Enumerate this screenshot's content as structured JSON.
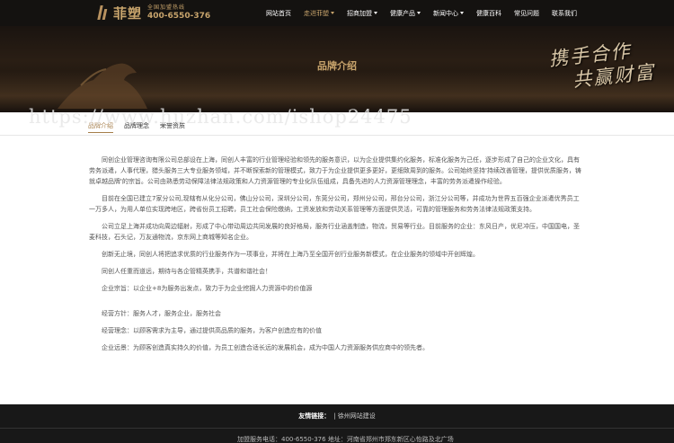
{
  "header": {
    "brand_name": "菲塑",
    "hotline_label": "全国加盟热线",
    "hotline_number": "400-6550-376"
  },
  "nav": {
    "items": [
      {
        "label": "网站首页",
        "dropdown": false,
        "active": false
      },
      {
        "label": "走进菲塑",
        "dropdown": true,
        "active": true
      },
      {
        "label": "招商加盟",
        "dropdown": true,
        "active": false
      },
      {
        "label": "健康产品",
        "dropdown": true,
        "active": false
      },
      {
        "label": "新闻中心",
        "dropdown": true,
        "active": false
      },
      {
        "label": "健康百科",
        "dropdown": false,
        "active": false
      },
      {
        "label": "常见问题",
        "dropdown": false,
        "active": false
      },
      {
        "label": "联系我们",
        "dropdown": false,
        "active": false
      }
    ]
  },
  "banner": {
    "title": "品牌介绍",
    "slogan_line1": "携手合作",
    "slogan_line2": "共赢财富"
  },
  "watermark": "https://www.huzhan.com/ishop24475",
  "subtabs": [
    "品牌介绍",
    "品牌理念",
    "荣誉资质"
  ],
  "content": {
    "paragraphs": [
      "同创企业管理咨询有限公司总部设在上海，同创人丰富的行业管理经验和领先的服务意识，以为企业提供集约化服务，标准化服务为己任，逐步形成了自己的企业文化，具有劳务派遣，人事代理，猎头服务三大专业服务领域，并不断探索新的管理模式，致力于为企业提供更多更好，更细致周到的服务。公司始终坚持'持续改善管理，提供优质服务，铸就卓越品牌'的宗旨。公司由熟悉劳动保障法律法规政策和人力资源管理的专业化队伍组成，具备先进的人力资源管理理念，丰富的劳务派遣操作经验。",
      "目前在全国已建立7家分公司,现辖有从化分公司，佛山分公司，深圳分公司，东莞分公司，郑州分公司，邢台分公司，浙江分公司等，并成功为世界五百强企业派遣优秀员工一万多人，为用人单位实现跨地区，跨省份员工招聘，员工社会保险缴纳，工资发放和劳动关系管理等方面提供灵活，可靠的管理服务和劳务法律法规政策支持。",
      "公司立足上海并成功向周边辐射，形成了中心带动周边共同发展的良好格局，服务行业涵盖制造，物流，贸易等行业。目前服务的企业：东风日产，优尼冲压，中国国电，圣麦科技，石头记，万友通物流，京东网上商城等知名企业。",
      "创新无止境，同创人将把追求优质的行业服务作为一项事业，并将在上海乃至全国开创行业服务新模式，在企业服务的领域中开创辉煌。",
      "同创人任重而道远，期待与各企管精英携手，共谱和谐社会！",
      "企业宗旨：以企业+8为服务出发点，致力于为企业挖掘人力资源中的价值源"
    ],
    "lines": [
      "经营方针：服务人才，服务企业，服务社会",
      "经营理念：以顾客需求为主导，通过提供高品质的服务，为客户创造应有的价值",
      "企业远景：为顾客创造真实持久的价值，为员工创造合适长远的发展机会，成为中国人力资源服务供应商中的领先者。"
    ]
  },
  "footer": {
    "friend_links_label": "友情链接：",
    "friend_link": "| 徐州网站建设",
    "contact": "加盟服务电话：400-6550-376 地址：河南省郑州市郑东新区心怡路及北广场"
  }
}
